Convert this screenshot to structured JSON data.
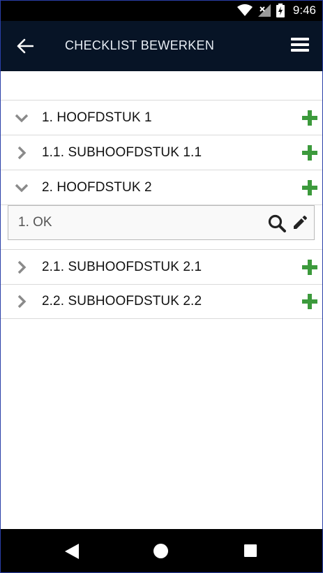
{
  "status_bar": {
    "time": "9:46",
    "icons": [
      "wifi-icon",
      "signal-icon",
      "battery-charging-icon"
    ]
  },
  "app_bar": {
    "title": "CHECKLIST BEWERKEN",
    "back_icon": "arrow-left-icon",
    "menu_icon": "hamburger-menu-icon"
  },
  "list": {
    "rows": [
      {
        "label": "1. HOOFDSTUK 1",
        "expanded": true,
        "icon": "chevron-down-icon"
      },
      {
        "label": "1.1. SUBHOOFDSTUK 1.1",
        "expanded": false,
        "icon": "chevron-right-icon"
      },
      {
        "label": "2. HOOFDSTUK 2",
        "expanded": true,
        "icon": "chevron-down-icon"
      }
    ],
    "item": {
      "label": "1. OK",
      "icons": [
        "search-icon",
        "pencil-icon"
      ]
    },
    "rows_after": [
      {
        "label": "2.1. SUBHOOFDSTUK 2.1",
        "expanded": false,
        "icon": "chevron-right-icon"
      },
      {
        "label": "2.2. SUBHOOFDSTUK 2.2",
        "expanded": false,
        "icon": "chevron-right-icon"
      }
    ],
    "add_icon": "plus-icon"
  },
  "colors": {
    "app_bar": "#071426",
    "add_green": "#3c9a3c",
    "chevron_gray": "#8a8a8a"
  },
  "nav_bar": {
    "icons": [
      "nav-back-icon",
      "nav-home-icon",
      "nav-recent-icon"
    ]
  }
}
